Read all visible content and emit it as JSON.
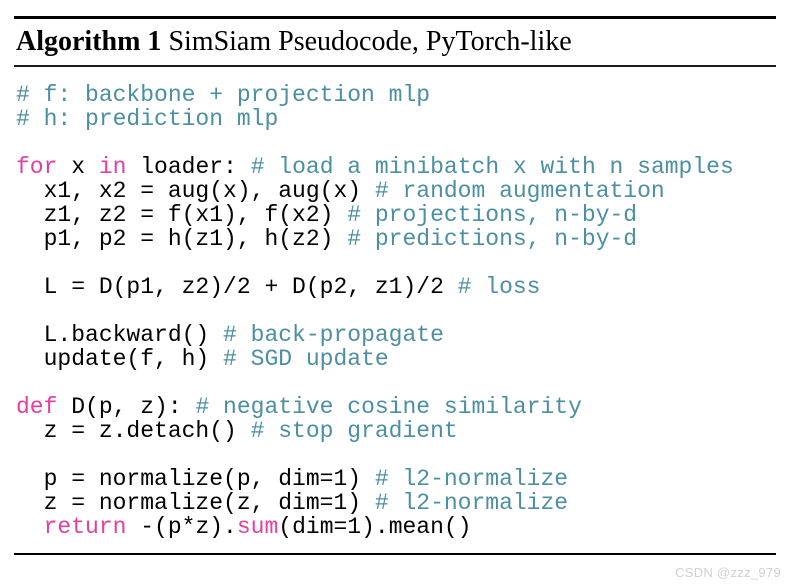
{
  "document": {
    "type": "algorithm-pseudocode-float",
    "background_color": "#ffffff"
  },
  "title": {
    "label": "Algorithm 1",
    "name": "SimSiam Pseudocode, PyTorch-like",
    "full": "Algorithm 1 SimSiam Pseudocode, PyTorch-like"
  },
  "colors": {
    "keyword": "#e53f9e",
    "comment": "#4b8fa0",
    "plain": "#000000",
    "rule": "#000000",
    "watermark": "#cfcfcf"
  },
  "code": {
    "language": "python",
    "lines": [
      {
        "id": "l1",
        "tokens": [
          {
            "t": "# f: backbone + projection mlp",
            "k": "cm"
          }
        ]
      },
      {
        "id": "l2",
        "tokens": [
          {
            "t": "# h: prediction mlp",
            "k": "cm"
          }
        ]
      },
      {
        "id": "l3",
        "tokens": []
      },
      {
        "id": "l4",
        "tokens": [
          {
            "t": "for",
            "k": "kw"
          },
          {
            "t": " x ",
            "k": "pl"
          },
          {
            "t": "in",
            "k": "kw"
          },
          {
            "t": " loader: ",
            "k": "pl"
          },
          {
            "t": "# load a minibatch x with n samples",
            "k": "cm"
          }
        ]
      },
      {
        "id": "l5",
        "tokens": [
          {
            "t": "  x1, x2 = aug(x), aug(x) ",
            "k": "pl"
          },
          {
            "t": "# random augmentation",
            "k": "cm"
          }
        ]
      },
      {
        "id": "l6",
        "tokens": [
          {
            "t": "  z1, z2 = f(x1), f(x2) ",
            "k": "pl"
          },
          {
            "t": "# projections, n-by-d",
            "k": "cm"
          }
        ]
      },
      {
        "id": "l7",
        "tokens": [
          {
            "t": "  p1, p2 = h(z1), h(z2) ",
            "k": "pl"
          },
          {
            "t": "# predictions, n-by-d",
            "k": "cm"
          }
        ]
      },
      {
        "id": "l8",
        "tokens": []
      },
      {
        "id": "l9",
        "tokens": [
          {
            "t": "  L = D(p1, z2)/2 + D(p2, z1)/2 ",
            "k": "pl"
          },
          {
            "t": "# loss",
            "k": "cm"
          }
        ]
      },
      {
        "id": "l10",
        "tokens": []
      },
      {
        "id": "l11",
        "tokens": [
          {
            "t": "  L.backward() ",
            "k": "pl"
          },
          {
            "t": "# back-propagate",
            "k": "cm"
          }
        ]
      },
      {
        "id": "l12",
        "tokens": [
          {
            "t": "  update(f, h) ",
            "k": "pl"
          },
          {
            "t": "# SGD update",
            "k": "cm"
          }
        ]
      },
      {
        "id": "l13",
        "tokens": []
      },
      {
        "id": "l14",
        "tokens": [
          {
            "t": "def",
            "k": "kw"
          },
          {
            "t": " D(p, z): ",
            "k": "pl"
          },
          {
            "t": "# negative cosine similarity",
            "k": "cm"
          }
        ]
      },
      {
        "id": "l15",
        "tokens": [
          {
            "t": "  z = z.detach() ",
            "k": "pl"
          },
          {
            "t": "# stop gradient",
            "k": "cm"
          }
        ]
      },
      {
        "id": "l16",
        "tokens": []
      },
      {
        "id": "l17",
        "tokens": [
          {
            "t": "  p = normalize(p, dim=1) ",
            "k": "pl"
          },
          {
            "t": "# l2-normalize",
            "k": "cm"
          }
        ]
      },
      {
        "id": "l18",
        "tokens": [
          {
            "t": "  z = normalize(z, dim=1) ",
            "k": "pl"
          },
          {
            "t": "# l2-normalize",
            "k": "cm"
          }
        ]
      },
      {
        "id": "l19",
        "tokens": [
          {
            "t": "  ",
            "k": "pl"
          },
          {
            "t": "return",
            "k": "kw"
          },
          {
            "t": " -(p*z).",
            "k": "pl"
          },
          {
            "t": "sum",
            "k": "kw"
          },
          {
            "t": "(dim=1).mean()",
            "k": "pl"
          }
        ]
      }
    ]
  },
  "watermark": {
    "text": "CSDN @zzz_979"
  }
}
